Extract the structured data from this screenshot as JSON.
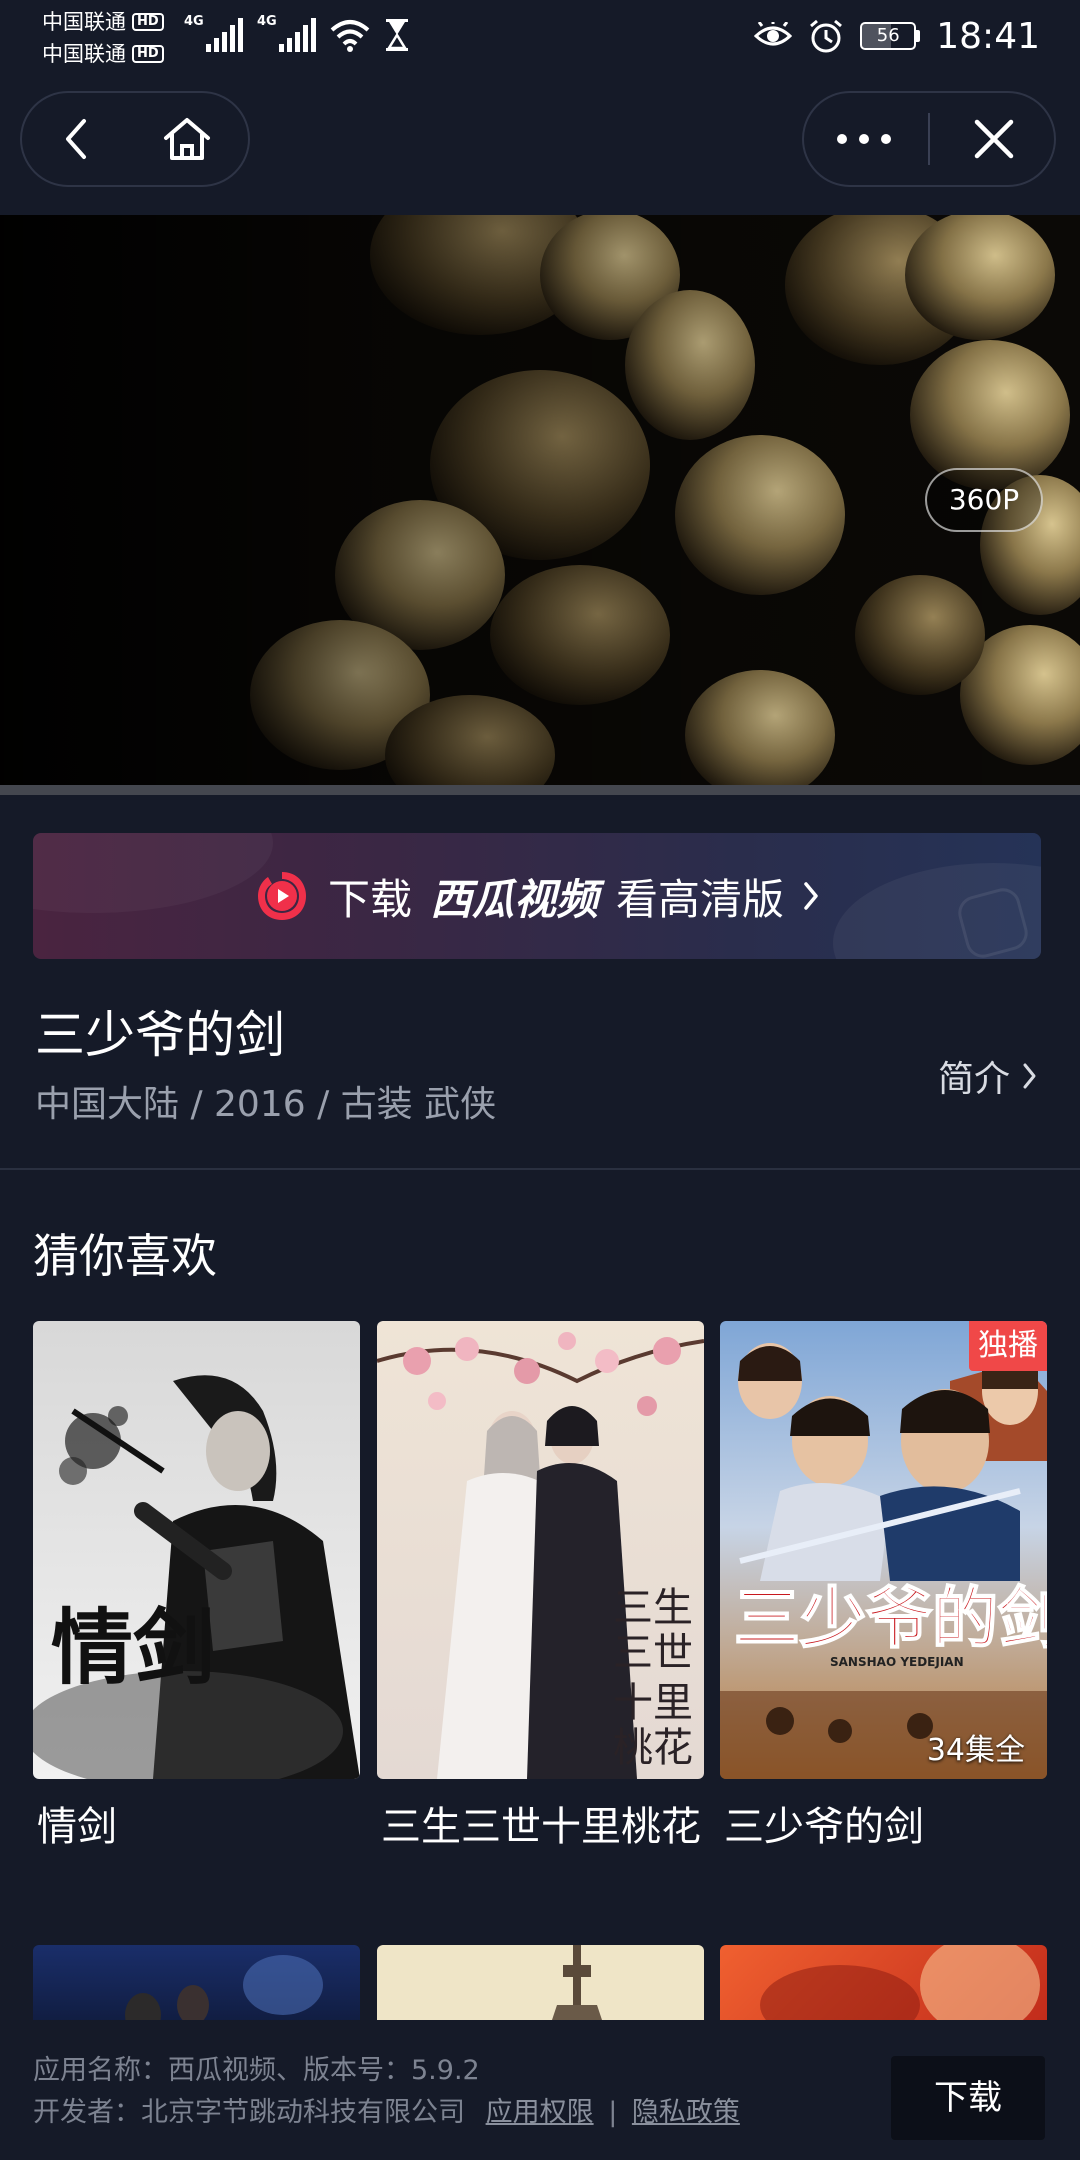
{
  "status_bar": {
    "carrier1": "中国联通",
    "carrier2": "中国联通",
    "hd": "HD",
    "network": "4G",
    "battery": "56",
    "time": "18:41"
  },
  "video": {
    "quality": "360P"
  },
  "banner": {
    "prefix": "下载",
    "brand": "西瓜视频",
    "suffix": "看高清版"
  },
  "show": {
    "title": "三少爷的剑",
    "meta": "中国大陆 / 2016 / 古装 武侠",
    "intro_label": "简介"
  },
  "recommend": {
    "section_title": "猜你喜欢",
    "items": [
      {
        "title": "情剑",
        "poster_text": "情剑"
      },
      {
        "title": "三生三世十里桃花",
        "poster_text": "三生三世十里桃花"
      },
      {
        "title": "三少爷的剑",
        "poster_text": "三少爷的剑",
        "badge": "独播",
        "episodes": "34集全",
        "poster_sub": "SANSHAO YEDEJIAN"
      }
    ]
  },
  "footer": {
    "app_info": "应用名称：西瓜视频、版本号：5.9.2",
    "developer": "开发者：北京字节跳动科技有限公司",
    "permissions": "应用权限",
    "separator": "|",
    "privacy": "隐私政策",
    "download": "下载"
  },
  "colors": {
    "background": "#151a28",
    "exclusive_badge": "#f04848",
    "logo_red": "#f0304a"
  }
}
